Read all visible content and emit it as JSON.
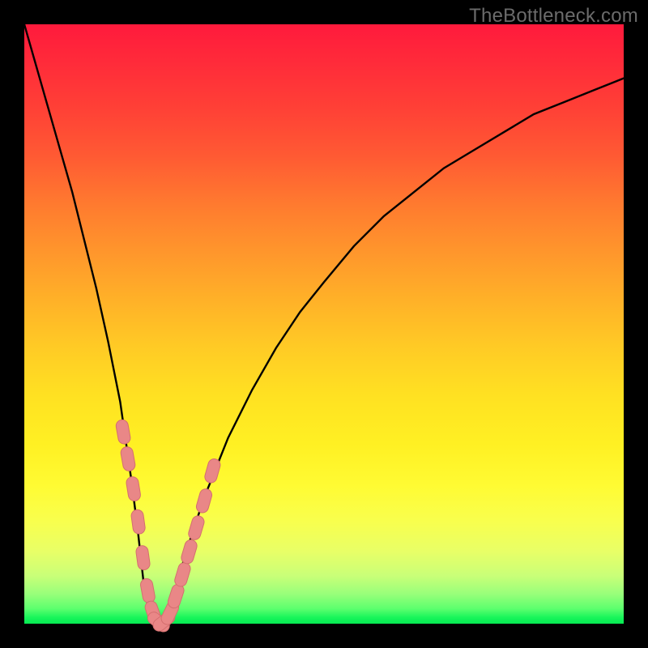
{
  "watermark": "TheBottleneck.com",
  "colors": {
    "frame": "#000000",
    "curve": "#000000",
    "marker_fill": "#e98787",
    "marker_stroke": "#d46f6f"
  },
  "chart_data": {
    "type": "line",
    "title": "",
    "xlabel": "",
    "ylabel": "",
    "xlim": [
      0,
      100
    ],
    "ylim": [
      0,
      100
    ],
    "series": [
      {
        "name": "bottleneck-curve",
        "x": [
          0,
          2,
          4,
          6,
          8,
          10,
          12,
          14,
          16,
          18,
          19,
          20,
          21,
          22,
          23,
          24,
          25,
          27,
          30,
          34,
          38,
          42,
          46,
          50,
          55,
          60,
          65,
          70,
          75,
          80,
          85,
          90,
          95,
          100
        ],
        "values": [
          100,
          93,
          86,
          79,
          72,
          64,
          56,
          47,
          37,
          23,
          15,
          6,
          1,
          0,
          0,
          1,
          5,
          12,
          21,
          31,
          39,
          46,
          52,
          57,
          63,
          68,
          72,
          76,
          79,
          82,
          85,
          87,
          89,
          91
        ]
      }
    ],
    "markers": {
      "name": "highlighted-points",
      "x": [
        16.5,
        17.3,
        18.2,
        19.0,
        19.8,
        20.6,
        21.5,
        22.4,
        23.3,
        24.3,
        25.3,
        26.4,
        27.5,
        28.7,
        30.0,
        31.4
      ],
      "values": [
        32.0,
        27.5,
        22.5,
        17.0,
        11.0,
        5.5,
        1.8,
        0.3,
        0.4,
        1.8,
        4.6,
        8.2,
        12.0,
        16.0,
        20.5,
        25.5
      ]
    }
  }
}
